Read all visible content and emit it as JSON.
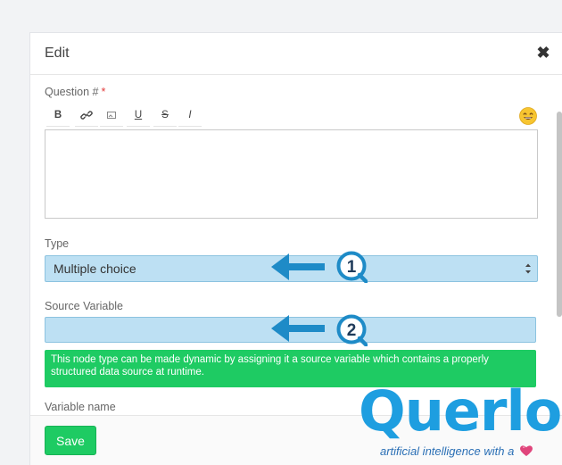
{
  "dialog": {
    "title": "Edit",
    "close_icon": "close-icon"
  },
  "question": {
    "label": "Question #",
    "required_mark": "*",
    "toolbar": {
      "bold": "B",
      "link_icon": "link-icon",
      "image_icon": "image-icon",
      "underline": "U",
      "strike": "S",
      "italic": "I",
      "emoji_icon": "emoji-icon"
    },
    "editor_value": ""
  },
  "type": {
    "label": "Type",
    "selected": "Multiple choice"
  },
  "source_variable": {
    "label": "Source Variable",
    "value": "",
    "help_text": "This node type can be made dynamic by assigning it a source variable which contains a properly structured data source at runtime."
  },
  "variable_name": {
    "label": "Variable name"
  },
  "footer": {
    "save_label": "Save"
  },
  "annotations": {
    "badge_1": "1",
    "badge_2": "2"
  },
  "logo": {
    "wordmark": "Querlo",
    "tagline": "artificial intelligence with a"
  },
  "colors": {
    "accent_green": "#1ecb63",
    "input_highlight": "#bde0f3",
    "annotation_blue": "#1e8bc7",
    "logo_blue": "#1e9ee0"
  }
}
